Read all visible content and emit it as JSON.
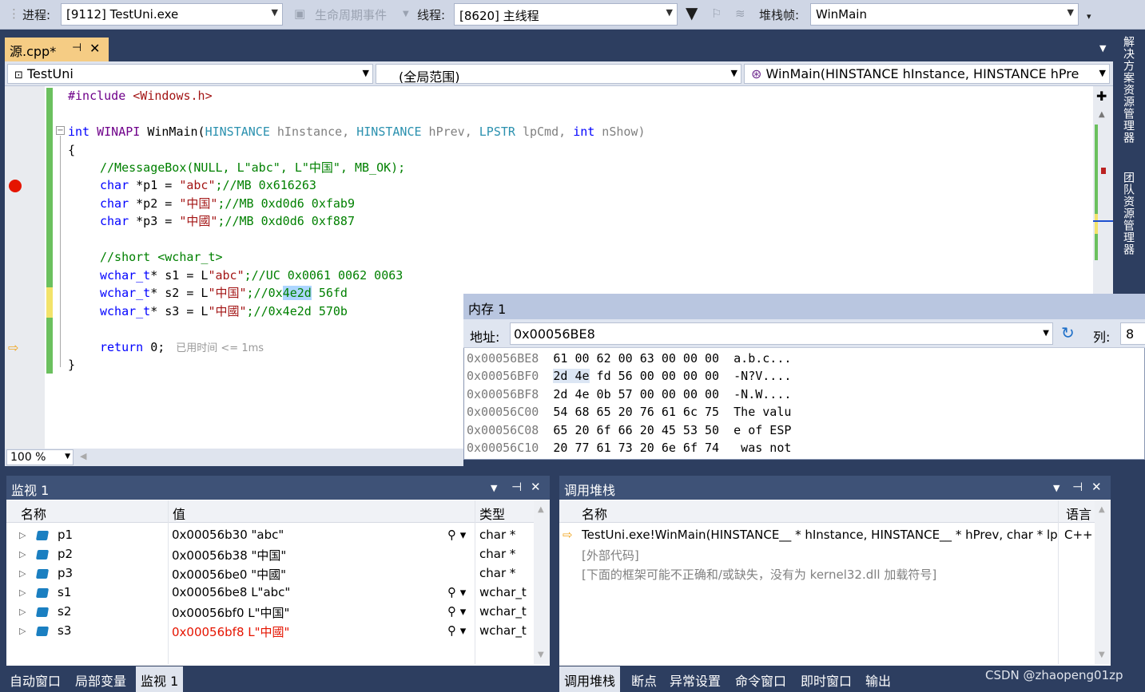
{
  "toolbar": {
    "process_label": "进程:",
    "process_value": "[9112] TestUni.exe",
    "lifecycle_label": "生命周期事件",
    "thread_label": "线程:",
    "thread_value": "[8620] 主线程",
    "stackframe_label": "堆栈帧:",
    "stackframe_value": "WinMain"
  },
  "doc_tab": {
    "name": "源.cpp*",
    "pin": "⊣",
    "close": "✕"
  },
  "navbar": {
    "project": "TestUni",
    "scope": "(全局范围)",
    "function": "WinMain(HINSTANCE hInstance, HINSTANCE hPre"
  },
  "code": {
    "l1_a": "#include ",
    "l1_b": "<Windows.h>",
    "l2_kw": "int ",
    "l2_mac": "WINAPI ",
    "l2_fn": "WinMain(",
    "l2_t1": "HINSTANCE",
    "l2_p1": " hInstance, ",
    "l2_t2": "HINSTANCE",
    "l2_p2": " hPrev, ",
    "l2_t3": "LPSTR",
    "l2_p3": " lpCmd, ",
    "l2_kw2": "int",
    "l2_p4": " nShow)",
    "l3": "{",
    "l4": "//MessageBox(NULL, L\"abc\", L\"中国\", MB_OK);",
    "l5_kw": "char",
    "l5_a": " *p1 = ",
    "l5_s": "\"abc\"",
    "l5_c": ";//MB 0x616263",
    "l6_kw": "char",
    "l6_a": " *p2 = ",
    "l6_s": "\"中国\"",
    "l6_c": ";//MB 0xd0d6 0xfab9",
    "l7_kw": "char",
    "l7_a": " *p3 = ",
    "l7_s": "\"中國\"",
    "l7_c": ";//MB 0xd0d6 0xf887",
    "l8": "//short <wchar_t>",
    "l9_kw": "wchar_t",
    "l9_a": "* s1 = L",
    "l9_s": "\"abc\"",
    "l9_c": ";//UC 0x0061 0062 0063",
    "l10_kw": "wchar_t",
    "l10_a": "* s2 = L",
    "l10_s": "\"中国\"",
    "l10_c1": ";//0x",
    "l10_sel": "4e2d",
    "l10_c2": " 56fd",
    "l11_kw": "wchar_t",
    "l11_a": "* s3 = L",
    "l11_s": "\"中國\"",
    "l11_c": ";//0x4e2d 570b",
    "l12_kw": "return",
    "l12_a": " 0;",
    "l12_hint": "已用时间 <= 1ms",
    "l13": "}"
  },
  "zoom": "100 %",
  "memory": {
    "title": "内存 1",
    "addr_label": "地址:",
    "addr_value": "0x00056BE8",
    "col_label": "列:",
    "col_value": "8",
    "rows": [
      {
        "addr": "0x00056BE8",
        "hex": "61 00 62 00 63 00 00 00",
        "ascii": "a.b.c..."
      },
      {
        "addr": "0x00056BF0",
        "hex_sel": "2d 4e",
        "hex": " fd 56 00 00 00 00",
        "ascii": "-N?V...."
      },
      {
        "addr": "0x00056BF8",
        "hex": "2d 4e 0b 57 00 00 00 00",
        "ascii": "-N.W...."
      },
      {
        "addr": "0x00056C00",
        "hex": "54 68 65 20 76 61 6c 75",
        "ascii": "The valu"
      },
      {
        "addr": "0x00056C08",
        "hex": "65 20 6f 66 20 45 53 50",
        "ascii": "e of ESP"
      },
      {
        "addr": "0x00056C10",
        "hex": "20 77 61 73 20 6e 6f 74",
        "ascii": " was not"
      }
    ]
  },
  "watch": {
    "title": "监视 1",
    "col_name": "名称",
    "col_value": "值",
    "col_type": "类型",
    "rows": [
      {
        "name": "p1",
        "value": "0x00056b30 \"abc\"",
        "type": "char *"
      },
      {
        "name": "p2",
        "value": "0x00056b38 \"中国\"",
        "type": "char *"
      },
      {
        "name": "p3",
        "value": "0x00056be0 \"中國\"",
        "type": "char *"
      },
      {
        "name": "s1",
        "value": "0x00056be8 L\"abc\"",
        "type": "wchar_t"
      },
      {
        "name": "s2",
        "value": "0x00056bf0 L\"中国\"",
        "type": "wchar_t"
      },
      {
        "name": "s3",
        "value": "0x00056bf8 L\"中國\"",
        "type": "wchar_t"
      }
    ]
  },
  "callstack": {
    "title": "调用堆栈",
    "col_name": "名称",
    "col_lang": "语言",
    "rows": [
      {
        "name": "TestUni.exe!WinMain(HINSTANCE__ * hInstance, HINSTANCE__ * hPrev, char * lp",
        "lang": "C++"
      },
      {
        "name": "[外部代码]",
        "lang": ""
      },
      {
        "name": "[下面的框架可能不正确和/或缺失，没有为 kernel32.dll 加载符号]",
        "lang": ""
      }
    ]
  },
  "bottom_tabs_left": [
    "自动窗口",
    "局部变量",
    "监视 1"
  ],
  "bottom_tabs_right": [
    "调用堆栈",
    "断点",
    "异常设置",
    "命令窗口",
    "即时窗口",
    "输出"
  ],
  "side_tabs": [
    "解决方案资源管理器",
    "团队资源管理器"
  ],
  "watermark": "CSDN @zhaopeng01zp",
  "colors": {
    "changed_value": "#e51400",
    "breakpoint": "#e51400",
    "active_tab": "#f5cc84"
  }
}
